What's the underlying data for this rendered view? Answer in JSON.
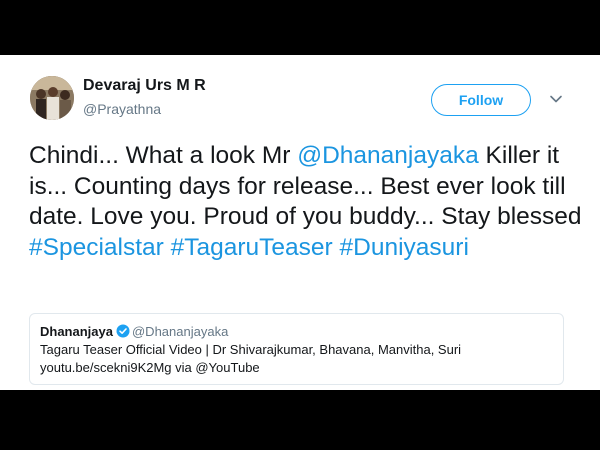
{
  "author": {
    "name": "Devaraj Urs M R",
    "handle": "@Prayathna"
  },
  "follow_label": "Follow",
  "tweet": {
    "t1": "Chindi... What a look Mr ",
    "mention": "@Dhananjayaka",
    "t2": " Killer it is... Counting days for release... Best ever look till date. Love you. Proud of you buddy... Stay blessed ",
    "hashtag1": "#Specialstar",
    "hashtag2": "#TagaruTeaser",
    "hashtag3": "#Duniyasuri"
  },
  "quoted": {
    "name": "Dhananjaya",
    "handle": "@Dhananjayaka",
    "line1": "Tagaru Teaser Official Video | Dr Shivarajkumar, Bhavana, Manvitha, Suri",
    "line2": "youtu.be/scekni9K2Mg via @YouTube"
  },
  "colors": {
    "link": "#1b95e0",
    "follow": "#1da1f2",
    "verified": "#1da1f2"
  },
  "icons": {
    "caret": "chevron-down-icon",
    "verified": "verified-badge-icon"
  }
}
